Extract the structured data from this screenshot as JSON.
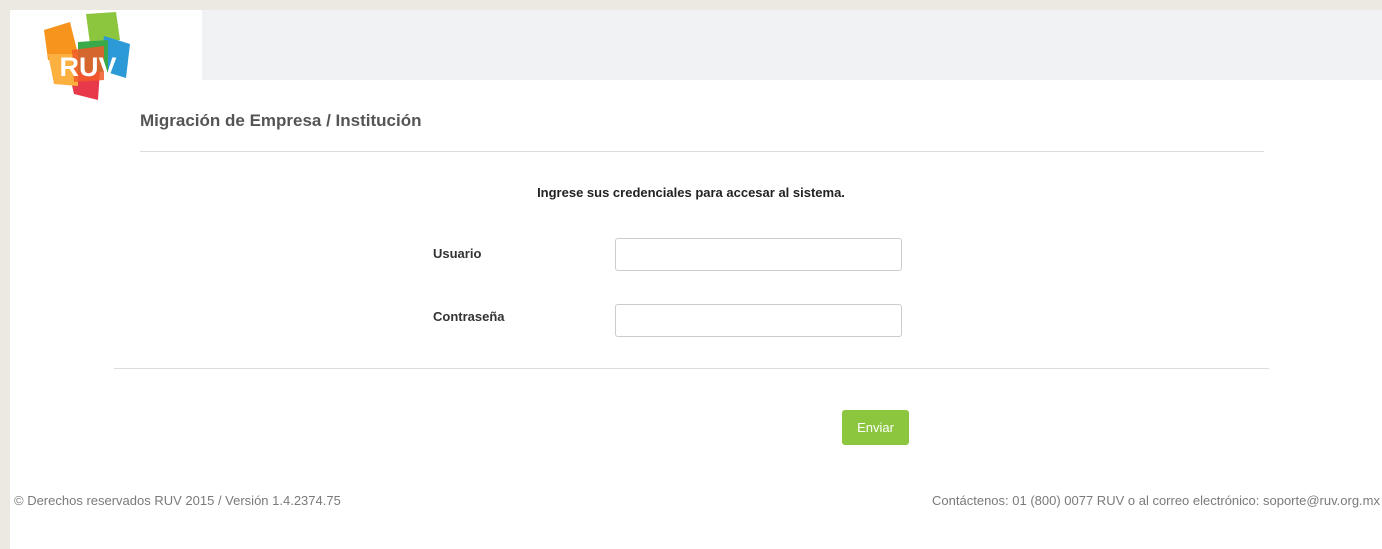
{
  "logo": {
    "text": "RUV",
    "colors": {
      "orange": "#f7941d",
      "green": "#8cc63f",
      "blue": "#2b9ad6",
      "red": "#e8394b",
      "yellow": "#fbb040"
    }
  },
  "page": {
    "title": "Migración de Empresa / Institución"
  },
  "form": {
    "instructions": "Ingrese sus credenciales para accesar al sistema.",
    "username_label": "Usuario",
    "username_value": "",
    "password_label": "Contraseña",
    "password_value": "",
    "submit_label": "Enviar"
  },
  "footer": {
    "copyright": "© Derechos reservados RUV 2015 / Versión 1.4.2374.75",
    "contact": "Contáctenos: 01 (800) 0077 RUV o al correo electrónico: soporte@ruv.org.mx"
  },
  "colors": {
    "accent_button": "#8cc63f",
    "background": "#ece9e2",
    "topbar": "#f1f2f4"
  }
}
